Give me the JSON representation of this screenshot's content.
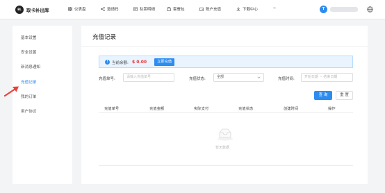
{
  "header": {
    "logo_text": "BL",
    "brand": "取卡补出库",
    "nav": [
      {
        "label": "仪表盘",
        "icon": "dashboard-icon"
      },
      {
        "label": "邀请码",
        "icon": "share-icon"
      },
      {
        "label": "私钥明细",
        "icon": "key-icon"
      },
      {
        "label": "套餐包",
        "icon": "package-icon"
      },
      {
        "label": "账户充值",
        "icon": "wallet-icon"
      },
      {
        "label": "下载中心",
        "icon": "download-icon"
      }
    ],
    "back_icon": "←",
    "avatar_text": "T"
  },
  "sidebar": {
    "items": [
      {
        "label": "基本设置"
      },
      {
        "label": "安全设置"
      },
      {
        "label": "新消息通知"
      },
      {
        "label": "充值记录",
        "active": true
      },
      {
        "label": "我的订单"
      },
      {
        "label": "用户协议"
      }
    ]
  },
  "main": {
    "title": "充值记录",
    "balance": {
      "label": "当前余额:",
      "amount": "$ 0.00",
      "button": "立即充值"
    },
    "filters": {
      "order_label": "充值单号:",
      "order_placeholder": "请输入充值单号",
      "status_label": "充值状态:",
      "status_value": "全部",
      "time_label": "充值时间:",
      "time_placeholder": "开始日期 ~ 结束日期"
    },
    "buttons": {
      "query": "查 询",
      "reset": "重 置"
    },
    "table": {
      "columns": [
        "充值单号",
        "充值金额",
        "实际支付",
        "充值状态",
        "创建时间",
        "操作"
      ],
      "empty_text": "暂无数据"
    }
  },
  "colors": {
    "accent": "#2d8cf0",
    "amount": "#f0302f",
    "arrow": "#e8433b"
  }
}
